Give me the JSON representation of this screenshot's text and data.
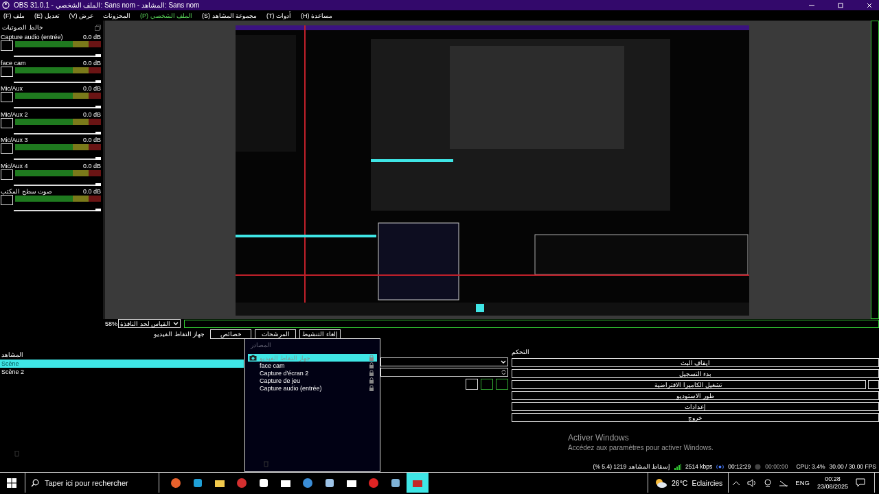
{
  "window": {
    "title": "OBS 31.0.1 - الملف الشخصي: Sans nom - المشاهد: Sans nom"
  },
  "menu": [
    {
      "label": "مساعدة (H)",
      "selected": false
    },
    {
      "label": "أدوات (T)",
      "selected": false
    },
    {
      "label": "مجموعة المشاهد (S)",
      "selected": false
    },
    {
      "label": "الملف الشخصي (P)",
      "selected": true
    },
    {
      "label": "المحزونات",
      "selected": false
    },
    {
      "label": "عرض (V)",
      "selected": false
    },
    {
      "label": "تعديل (E)",
      "selected": false
    },
    {
      "label": "ملف (F)",
      "selected": false
    }
  ],
  "mixer": {
    "title": "خالط الصوتيات",
    "channels": [
      {
        "name": "Capture audio (entrée)",
        "reading": "0.0 dB",
        "muted": false,
        "level": 1
      },
      {
        "name": "face cam",
        "reading": "0.0 dB",
        "muted": false,
        "level": 1
      },
      {
        "name": "Mic/Aux",
        "reading": "0.0 dB",
        "muted": false,
        "level": 1
      },
      {
        "name": "Mic/Aux 2",
        "reading": "0.0 dB",
        "muted": false,
        "level": 1
      },
      {
        "name": "Mic/Aux 3",
        "reading": "0.0 dB",
        "muted": false,
        "level": 1
      },
      {
        "name": "Mic/Aux 4",
        "reading": "0.0 dB",
        "muted": false,
        "level": 1
      },
      {
        "name": "صوت سطح المكتب",
        "reading": "0.0 dB",
        "muted": false,
        "level": 1
      }
    ]
  },
  "zoom": {
    "percent": "58%",
    "scale_mode": "القياس لحد النافذة"
  },
  "source_toolbar": {
    "source_name": "جهاز التقاط الفيديو",
    "buttons": [
      "إلغاء التنشيط",
      "المرشحات",
      "خصائص"
    ]
  },
  "scenes": {
    "title": "المشاهد",
    "items": [
      {
        "label": "Scène",
        "selected": true
      },
      {
        "label": "Scène 2",
        "selected": false
      }
    ]
  },
  "sources": {
    "title": "المصادر",
    "items": [
      {
        "label": "جهاز التقاط الفيديو",
        "selected": true
      },
      {
        "label": "face cam",
        "selected": false
      },
      {
        "label": "Capture d'écran 2",
        "selected": false
      },
      {
        "label": "Capture de jeu",
        "selected": false
      },
      {
        "label": "Capture audio (entrée)",
        "selected": false
      }
    ]
  },
  "controls": {
    "title": "التحكم",
    "buttons": [
      "ايقاف البث",
      "بدء التسجيل",
      "تشغيل الكاميرا الافتراضية",
      "طور الاستوديو",
      "إعدادات",
      "خروج"
    ]
  },
  "activation": {
    "title": "Activer Windows",
    "text": "Accédez aux paramètres pour activer Windows."
  },
  "status_bar": {
    "dropped": "إسقاط المشاهد 1219 (5.4 %)",
    "bitrate": "2514 kbps",
    "stream_time": "00:12:29",
    "record_time": "00:00:00",
    "cpu": "CPU: 3.4%",
    "fps": "30.00 / 30.00 FPS"
  },
  "taskbar": {
    "search_placeholder": "Taper ici pour rechercher",
    "temperature": "26°C",
    "weather": "Eclaircies",
    "language": "ENG",
    "time": "00:28",
    "date": "23/08/2025"
  }
}
